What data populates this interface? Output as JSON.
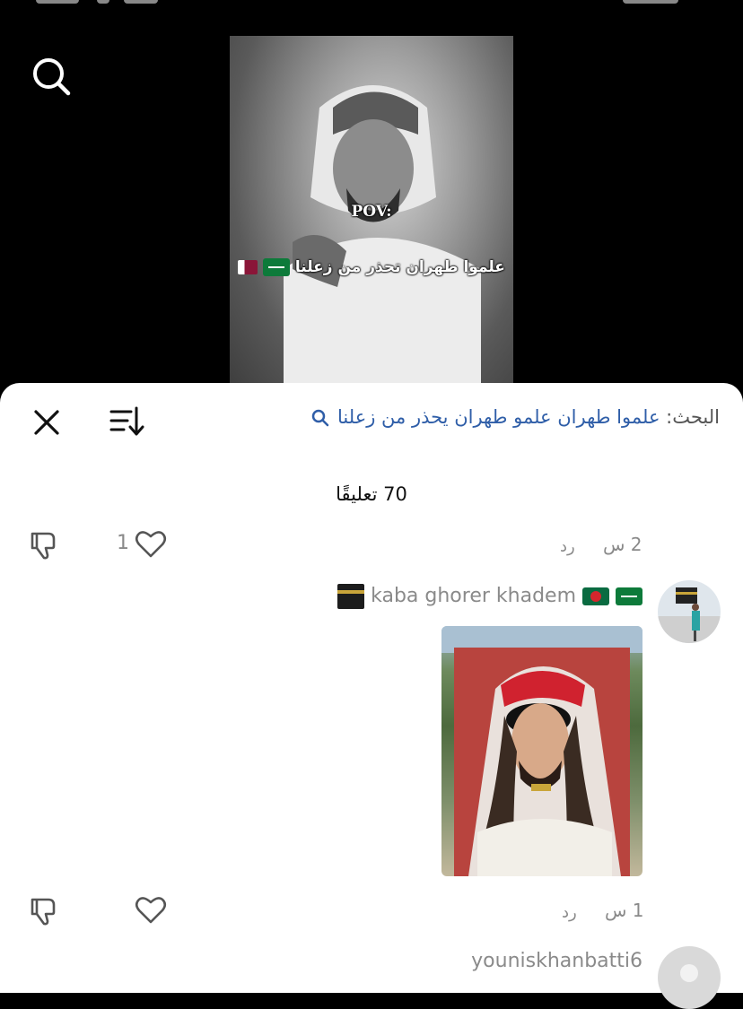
{
  "video": {
    "overlay_top": "POV:",
    "overlay_caption": "علموا طهران تحذر من زعلنا"
  },
  "sheet": {
    "search_label": "البحث:",
    "search_query": "علموا طهران علمو طهران يحذر من زعلنا",
    "comment_count": "70 تعليقًا"
  },
  "comments": [
    {
      "time": "2 س",
      "reply": "رد",
      "likes": "1"
    },
    {
      "username": "kaba ghorer khadem",
      "has_image": true
    },
    {
      "time": "1 س",
      "reply": "رد",
      "likes": ""
    },
    {
      "username": "youniskhanbatti6"
    }
  ],
  "icons": {
    "search": "search-icon",
    "close": "close-icon",
    "sort": "sort-icon",
    "like": "heart-icon",
    "dislike": "thumbs-down-icon"
  },
  "colors": {
    "link": "#2f5ea8",
    "muted": "#8a8a8a"
  }
}
